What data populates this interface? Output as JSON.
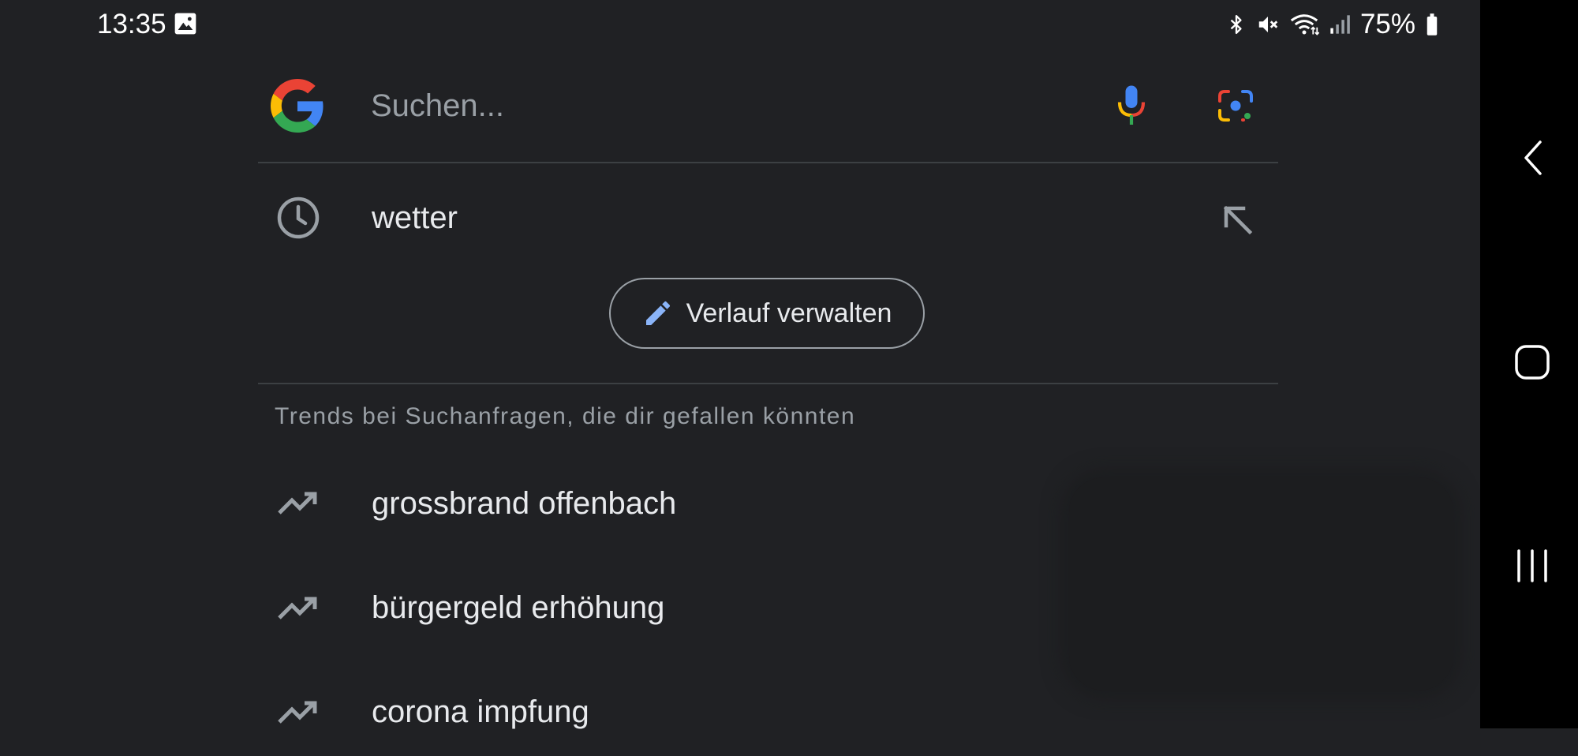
{
  "status_bar": {
    "time": "13:35",
    "battery": "75%",
    "icons": [
      "gallery-icon",
      "bluetooth-icon",
      "mute-icon",
      "wifi-icon",
      "signal-icon",
      "battery-icon"
    ]
  },
  "search": {
    "placeholder": "Suchen...",
    "value": ""
  },
  "history": {
    "items": [
      {
        "text": "wetter",
        "icon": "clock-icon"
      }
    ],
    "manage_label": "Verlauf verwalten"
  },
  "trends": {
    "heading": "Trends bei Suchanfragen, die dir gefallen könnten",
    "items": [
      {
        "text": "grossbrand offenbach"
      },
      {
        "text": "bürgergeld erhöhung"
      },
      {
        "text": "corona impfung"
      }
    ]
  },
  "nav": {
    "buttons": [
      "back",
      "home",
      "recent-apps"
    ]
  },
  "colors": {
    "background": "#202124",
    "navbar": "#000000",
    "text": "#e8eaed",
    "muted": "#9aa0a6",
    "accent_blue": "#8ab4f8"
  }
}
